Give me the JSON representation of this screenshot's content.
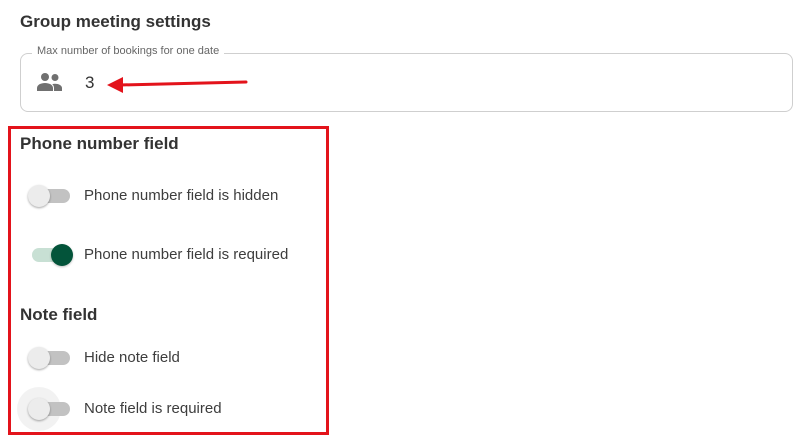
{
  "group_meeting": {
    "title": "Group meeting settings",
    "max_bookings_label": "Max number of bookings for one date",
    "max_bookings_value": "3",
    "field_icon": "group-people-icon"
  },
  "phone_section": {
    "title": "Phone number field",
    "toggles": [
      {
        "label": "Phone number field is hidden",
        "checked": false
      },
      {
        "label": "Phone number field is required",
        "checked": true
      }
    ]
  },
  "note_section": {
    "title": "Note field",
    "toggles": [
      {
        "label": "Hide note field",
        "checked": false
      },
      {
        "label": "Note field is required",
        "checked": false
      }
    ]
  },
  "colors": {
    "toggle_on": "#03543a",
    "annotation": "#e3131b"
  }
}
